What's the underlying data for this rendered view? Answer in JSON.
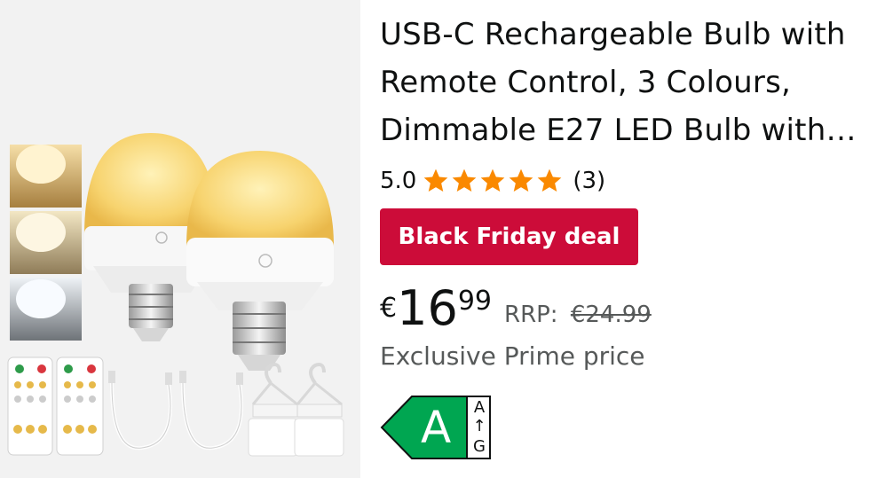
{
  "product": {
    "title_lines": [
      "USB-C Rechargeable Bulb with",
      "Remote Control, 3 Colours,",
      "Dimmable E27 LED Bulb with…"
    ],
    "rating": {
      "value": "5.0",
      "stars_filled": 5,
      "stars_total": 5,
      "count": "(3)",
      "star_color": "#fa8900"
    },
    "deal_badge": {
      "label": "Black Friday deal",
      "color": "#cc0c39"
    },
    "price": {
      "currency": "€",
      "whole": "16",
      "fraction": "99",
      "rrp_label": "RRP:",
      "rrp_value": "€24.99"
    },
    "prime_text": "Exclusive Prime price",
    "energy": {
      "class": "A",
      "scale_top": "A",
      "scale_arrow": "↑",
      "scale_bottom": "G",
      "color": "#00a651"
    }
  }
}
